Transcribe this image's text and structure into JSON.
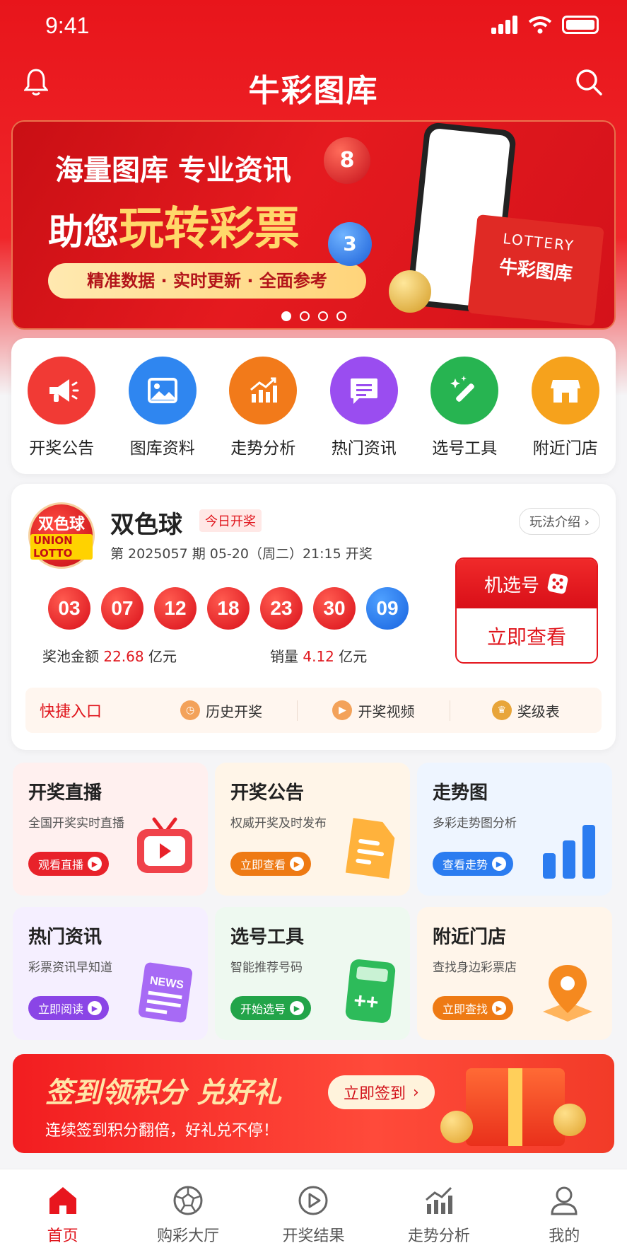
{
  "status": {
    "time": "9:41"
  },
  "header": {
    "title": "牛彩图库"
  },
  "banner": {
    "line1": "海量图库  专业资讯",
    "line2_prefix": "助您",
    "line2_highlight": "玩转彩票",
    "pill": "精准数据 · 实时更新 · 全面参考",
    "box_line1": "LOTTERY",
    "box_line2": "牛彩图库",
    "ball_top": "8",
    "ball_bottom": "3",
    "slides": 4,
    "active_slide": 1
  },
  "quick_menu": [
    {
      "label": "开奖公告",
      "icon": "megaphone-icon",
      "color": "#f13a35"
    },
    {
      "label": "图库资料",
      "icon": "image-icon",
      "color": "#2f86f0"
    },
    {
      "label": "走势分析",
      "icon": "chart-icon",
      "color": "#f27a1a"
    },
    {
      "label": "热门资讯",
      "icon": "message-icon",
      "color": "#9a4df0"
    },
    {
      "label": "选号工具",
      "icon": "magic-wand-icon",
      "color": "#27b451"
    },
    {
      "label": "附近门店",
      "icon": "store-icon",
      "color": "#f6a21c"
    }
  ],
  "lottery": {
    "logo_line1": "双色球",
    "logo_line2": "UNION LOTTO",
    "name": "双色球",
    "badge": "今日开奖",
    "rule_link": "玩法介绍",
    "issue": "第 2025057 期    05-20（周二）21:15 开奖",
    "red_balls": [
      "03",
      "07",
      "12",
      "18",
      "23",
      "30"
    ],
    "blue_ball": "09",
    "pool_label": "奖池金额",
    "pool_value": "22.68",
    "pool_unit": "亿元",
    "sales_label": "销量",
    "sales_value": "4.12",
    "sales_unit": "亿元",
    "machine_pick": "机选号",
    "view_now": "立即查看",
    "shortcut_head": "快捷入口",
    "shortcuts": [
      {
        "label": "历史开奖",
        "icon": "clock-icon"
      },
      {
        "label": "开奖视频",
        "icon": "play-icon"
      },
      {
        "label": "奖级表",
        "icon": "trophy-icon"
      }
    ]
  },
  "tiles": [
    {
      "title": "开奖直播",
      "sub": "全国开奖实时直播",
      "btn": "观看直播",
      "color": "#e8222a",
      "bg": "#fff0ef",
      "icon": "tv-icon"
    },
    {
      "title": "开奖公告",
      "sub": "权威开奖及时发布",
      "btn": "立即查看",
      "color": "#ee7a14",
      "bg": "#fff5e8",
      "icon": "document-icon"
    },
    {
      "title": "走势图",
      "sub": "多彩走势图分析",
      "btn": "查看走势",
      "color": "#2b7cf0",
      "bg": "#eef5ff",
      "icon": "bar-chart-icon"
    },
    {
      "title": "热门资讯",
      "sub": "彩票资讯早知道",
      "btn": "立即阅读",
      "color": "#8a45e6",
      "bg": "#f5efff",
      "icon": "news-icon"
    },
    {
      "title": "选号工具",
      "sub": "智能推荐号码",
      "btn": "开始选号",
      "color": "#22a449",
      "bg": "#eef9f0",
      "icon": "calculator-icon"
    },
    {
      "title": "附近门店",
      "sub": "查找身边彩票店",
      "btn": "立即查找",
      "color": "#ee7a14",
      "bg": "#fff5ea",
      "icon": "location-pin-icon"
    }
  ],
  "checkin": {
    "title": "签到领积分 兑好礼",
    "button": "立即签到",
    "subtitle": "连续签到积分翻倍，好礼兑不停！"
  },
  "tabbar": [
    {
      "label": "首页",
      "icon": "home-icon",
      "active": true
    },
    {
      "label": "购彩大厅",
      "icon": "football-icon",
      "active": false
    },
    {
      "label": "开奖结果",
      "icon": "play-circle-icon",
      "active": false
    },
    {
      "label": "走势分析",
      "icon": "trend-icon",
      "active": false
    },
    {
      "label": "我的",
      "icon": "user-icon",
      "active": false
    }
  ]
}
